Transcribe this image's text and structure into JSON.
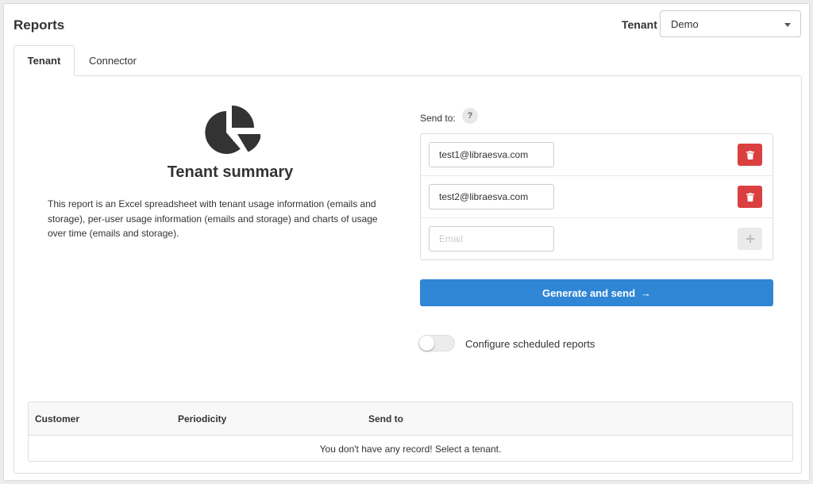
{
  "header": {
    "title": "Reports",
    "tenant_label": "Tenant",
    "tenant_selected": "Demo"
  },
  "tabs": [
    {
      "label": "Tenant",
      "active": true
    },
    {
      "label": "Connector",
      "active": false
    }
  ],
  "summary": {
    "icon": "pie-chart-icon",
    "title": "Tenant summary",
    "description": "This report is an Excel spreadsheet with tenant usage information (emails and storage), per-user usage information (emails and storage) and charts of usage over time (emails and storage)."
  },
  "send_to": {
    "label": "Send to:",
    "help": "?",
    "emails": [
      "test1@libraesva.com",
      "test2@libraesva.com"
    ],
    "new_placeholder": "Email",
    "delete_icon": "trash-icon",
    "add_icon": "plus-icon"
  },
  "generate_button": {
    "label": "Generate and send",
    "arrow": "→"
  },
  "scheduled": {
    "label": "Configure scheduled reports",
    "enabled": false
  },
  "table": {
    "columns": [
      "Customer",
      "Periodicity",
      "Send to"
    ],
    "empty_message": "You don't have any record! Select a tenant."
  },
  "colors": {
    "primary": "#2f86d5",
    "danger": "#d9403f"
  }
}
